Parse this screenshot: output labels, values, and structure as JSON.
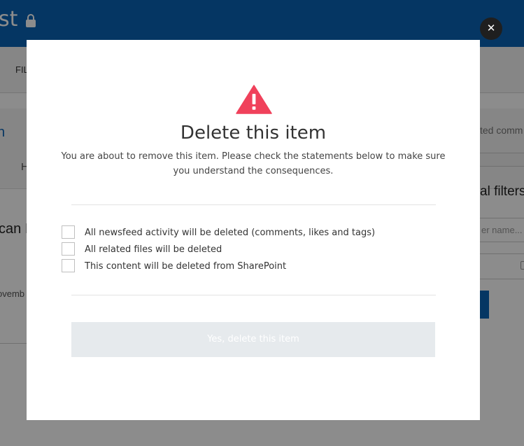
{
  "background": {
    "app_title_fragment": "st",
    "toolbar_fragment": "FIL",
    "left_link_fragment": "n",
    "tab_fragment": "H",
    "heading_fragment": "can I",
    "date_fragment": "ovemb",
    "right_comments_fragment": "ted comm",
    "right_filters_fragment": "al filters",
    "right_input_placeholder": "er name..."
  },
  "modal": {
    "title": "Delete this item",
    "description": "You are about to remove this item. Please check the statements below to make sure you understand the consequences.",
    "icon": "warning-triangle-icon",
    "accent_color": "#f0415b",
    "checklist": [
      {
        "label": "All newsfeed activity will be deleted (comments, likes and tags)",
        "checked": false
      },
      {
        "label": "All related files will be deleted",
        "checked": false
      },
      {
        "label": "This content will be deleted from SharePoint",
        "checked": false
      }
    ],
    "confirm_label": "Yes, delete this item",
    "confirm_enabled": false,
    "close_icon": "close-icon"
  }
}
